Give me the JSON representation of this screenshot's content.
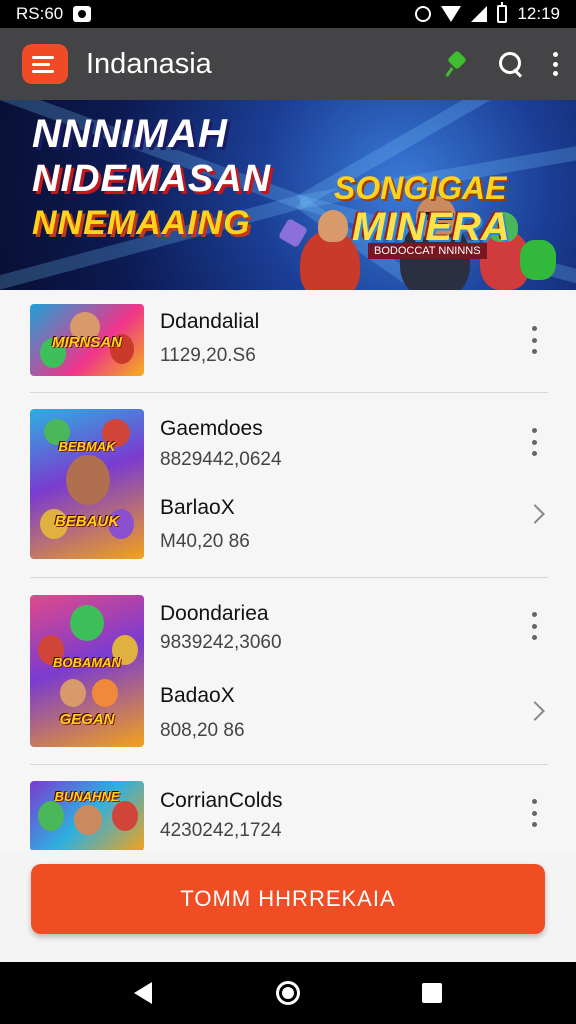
{
  "status_bar": {
    "time_left": "RS:60",
    "time_right": "12:19"
  },
  "app_bar": {
    "title": "Indanasia",
    "icons": [
      "menu-logo-icon",
      "pin-icon",
      "search-icon",
      "more-vert-icon"
    ]
  },
  "banner": {
    "line1": "NNNIMAH",
    "line2": "NIDEMASAN",
    "line3": "NNEMAAING",
    "logo_line1": "SONGIGAE",
    "logo_line2": "MINERA",
    "logo_tagline": "BODOCCAT NNINNS"
  },
  "list": {
    "items": [
      {
        "thumb_text": "MIRNSAN",
        "title": "Ddandalial",
        "sub": "1129,20.S6"
      },
      {
        "thumb_text": "BEBMAK",
        "thumb_text2": "BEBAUK",
        "title": "Gaemdoes",
        "sub": "8829442,0624",
        "title2": "BarlaoX",
        "sub2": "M40,20   86"
      },
      {
        "thumb_text": "BOBAMAN",
        "thumb_text2": "GEGAN",
        "title": "Doondariea",
        "sub": "9839242,3060",
        "title2": "BadaoX",
        "sub2": "808,20   86"
      },
      {
        "thumb_text": "BUNAHNE",
        "title": "CorrianColds",
        "sub": "4230242,1724"
      }
    ]
  },
  "cta": {
    "label": "TOMM HHRREKAIA"
  },
  "colors": {
    "accent": "#f04d24",
    "app_bar": "#444446"
  }
}
